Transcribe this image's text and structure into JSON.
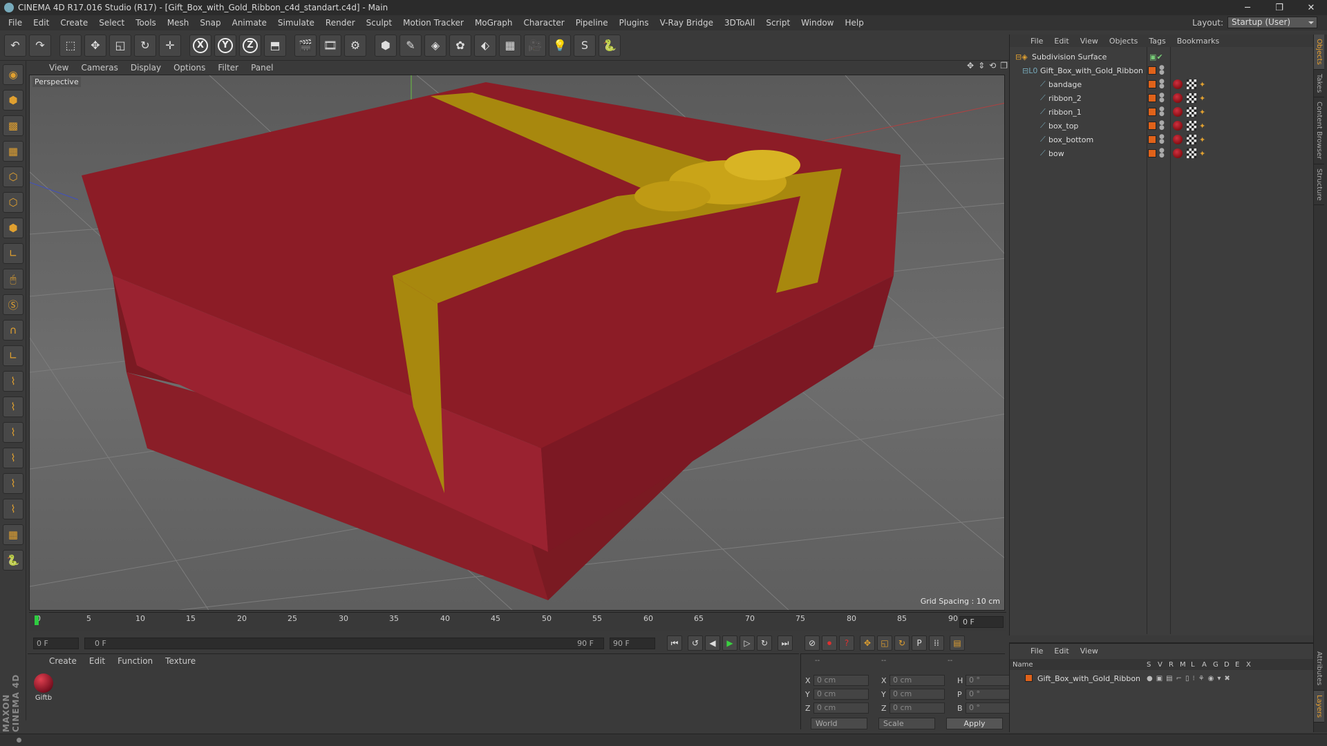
{
  "window": {
    "title": "CINEMA 4D R17.016 Studio (R17) - [Gift_Box_with_Gold_Ribbon_c4d_standart.c4d] - Main",
    "minimize": "─",
    "maximize": "❐",
    "close": "✕"
  },
  "menu": [
    "File",
    "Edit",
    "Create",
    "Select",
    "Tools",
    "Mesh",
    "Snap",
    "Animate",
    "Simulate",
    "Render",
    "Sculpt",
    "Motion Tracker",
    "MoGraph",
    "Character",
    "Pipeline",
    "Plugins",
    "V-Ray Bridge",
    "3DToAll",
    "Script",
    "Window",
    "Help"
  ],
  "layout": {
    "label": "Layout:",
    "value": "Startup (User)"
  },
  "toolbar": {
    "undo": "↶",
    "redo": "↷",
    "select": "⬚",
    "move": "✥",
    "scale": "◱",
    "rotate": "↻",
    "transform": "✛",
    "axis_x": "X",
    "axis_y": "Y",
    "axis_z": "Z",
    "coord": "⬒",
    "render_view": "🎬",
    "render_region": "🎞",
    "render_settings": "⚙",
    "cube": "⬢",
    "pen": "✎",
    "subdiv": "◈",
    "mograph": "✿",
    "deformer": "⬖",
    "floor": "▦",
    "camera": "🎥",
    "light": "💡",
    "vray": "S",
    "python": "🐍"
  },
  "viewport_menu": [
    "View",
    "Cameras",
    "Display",
    "Options",
    "Filter",
    "Panel"
  ],
  "viewport": {
    "label": "Perspective",
    "grid_spacing": "Grid Spacing : 10 cm",
    "nav_icons": [
      "✥",
      "⇕",
      "⟲",
      "❐"
    ]
  },
  "timeline": {
    "ticks": [
      "0",
      "5",
      "10",
      "15",
      "20",
      "25",
      "30",
      "35",
      "40",
      "45",
      "50",
      "55",
      "60",
      "65",
      "70",
      "75",
      "80",
      "85",
      "90"
    ],
    "frame": "0 F"
  },
  "playback": {
    "start": "0 F",
    "scrub_start": "0 F",
    "scrub_end": "90 F",
    "end": "90 F",
    "buttons": [
      "⏮",
      "↺",
      "◀",
      "▶",
      "▷",
      "↻",
      "⏭"
    ],
    "key_buttons": [
      "⊘",
      "⏺",
      "?",
      "✥",
      "◱",
      "↻",
      "P",
      "⁞⁞",
      "▤"
    ]
  },
  "material_menu": [
    "Create",
    "Edit",
    "Function",
    "Texture"
  ],
  "material": {
    "name": "Giftb"
  },
  "coords": {
    "headers": [
      "--",
      "--",
      "--"
    ],
    "rows": [
      {
        "a": "X",
        "av": "0 cm",
        "b": "X",
        "bv": "0 cm",
        "c": "H",
        "cv": "0 °"
      },
      {
        "a": "Y",
        "av": "0 cm",
        "b": "Y",
        "bv": "0 cm",
        "c": "P",
        "cv": "0 °"
      },
      {
        "a": "Z",
        "av": "0 cm",
        "b": "Z",
        "bv": "0 cm",
        "c": "B",
        "cv": "0 °"
      }
    ],
    "world": "World",
    "scale": "Scale",
    "apply": "Apply"
  },
  "object_menu": [
    "File",
    "Edit",
    "View",
    "Objects",
    "Tags",
    "Bookmarks"
  ],
  "objects": [
    {
      "name": "Subdivision Surface",
      "indent": 0,
      "tags": false
    },
    {
      "name": "Gift_Box_with_Gold_Ribbon",
      "indent": 1,
      "tags": false
    },
    {
      "name": "bandage",
      "indent": 2,
      "tags": true
    },
    {
      "name": "ribbon_2",
      "indent": 2,
      "tags": true
    },
    {
      "name": "ribbon_1",
      "indent": 2,
      "tags": true
    },
    {
      "name": "box_top",
      "indent": 2,
      "tags": true
    },
    {
      "name": "box_bottom",
      "indent": 2,
      "tags": true
    },
    {
      "name": "bow",
      "indent": 2,
      "tags": true
    }
  ],
  "layer_menu": [
    "File",
    "Edit",
    "View"
  ],
  "layer_headers": {
    "name": "Name",
    "cols": [
      "S",
      "V",
      "R",
      "M",
      "L",
      "A",
      "G",
      "D",
      "E",
      "X"
    ]
  },
  "layer_row": {
    "name": "Gift_Box_with_Gold_Ribbon"
  },
  "right_tabs": [
    "Objects",
    "Takes",
    "Content Browser",
    "Structure"
  ],
  "right_tabs_lower": [
    "Attributes",
    "Layers"
  ],
  "maxon": "MAXON CINEMA 4D"
}
